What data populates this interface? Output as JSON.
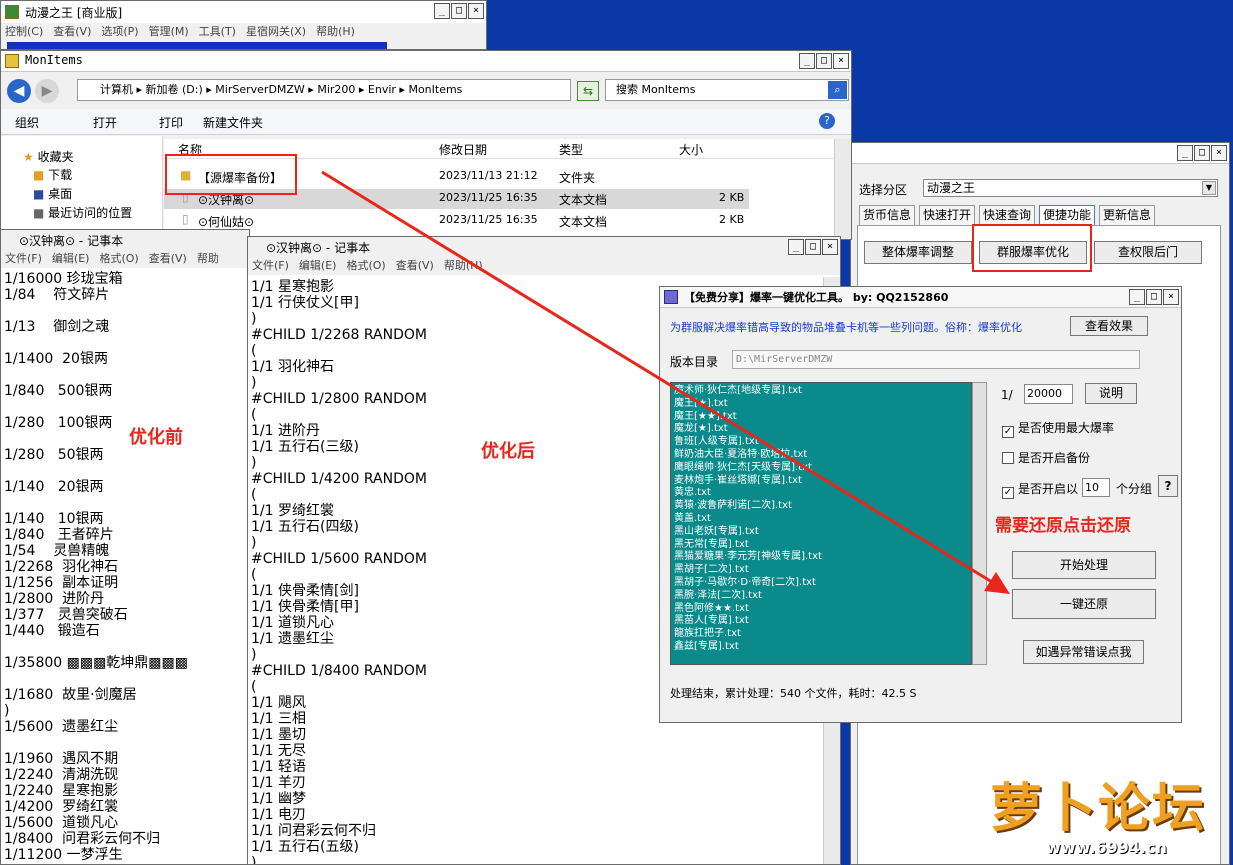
{
  "main_window": {
    "title": "动漫之王 [商业版]",
    "menu": [
      "控制(C)",
      "查看(V)",
      "选项(P)",
      "管理(M)",
      "工具(T)",
      "星宿网关(X)",
      "帮助(H)"
    ]
  },
  "explorer": {
    "title": "MonItems",
    "breadcrumb": [
      "计算机",
      "新加卷 (D:)",
      "MirServerDMZW",
      "Mir200",
      "Envir",
      "MonItems"
    ],
    "search_placeholder": "搜索 MonItems",
    "toolbar": {
      "organize": "组织",
      "open": "打开",
      "print": "打印",
      "new_folder": "新建文件夹"
    },
    "nav": [
      "收藏夹",
      "下载",
      "桌面",
      "最近访问的位置"
    ],
    "columns": [
      "名称",
      "修改日期",
      "类型",
      "大小"
    ],
    "files": [
      {
        "name": "【源爆率备份】",
        "date": "2023/11/13 21:12",
        "type": "文件夹",
        "size": ""
      },
      {
        "name": "⊙汉钟离⊙",
        "date": "2023/11/25 16:35",
        "type": "文本文档",
        "size": "2 KB"
      },
      {
        "name": "⊙何仙姑⊙",
        "date": "2023/11/25 16:35",
        "type": "文本文档",
        "size": "2 KB"
      }
    ]
  },
  "notepad1": {
    "title": "⊙汉钟离⊙ - 记事本",
    "menu": [
      "文件(F)",
      "编辑(E)",
      "格式(O)",
      "查看(V)",
      "帮助"
    ],
    "lines": [
      "1/16000 珍珑宝箱",
      "1/84    符文碎片",
      "",
      "1/13    御剑之魂",
      "",
      "1/1400  20银两",
      "",
      "1/840   500银两",
      "",
      "1/280   100银两",
      "",
      "1/280   50银两",
      "",
      "1/140   20银两",
      "",
      "1/140   10银两",
      "1/840   王者碎片",
      "1/54    灵兽精魄",
      "1/2268  羽化神石",
      "1/1256  副本证明",
      "1/2800  进阶丹",
      "1/377   灵兽突破石",
      "1/440   锻造石",
      "",
      "1/35800 ▩▩▩乾坤鼎▩▩▩",
      "",
      "1/1680  故里·剑魔居",
      ")",
      "1/5600  遗墨红尘",
      "",
      "1/1960  遇风不期",
      "1/2240  清湖洗砚",
      "1/2240  星寒抱影",
      "1/4200  罗绮红裳",
      "1/5600  道锁凡心",
      "1/8400  问君彩云何不归",
      "1/11200 一梦浮生"
    ]
  },
  "notepad2": {
    "title": "⊙汉钟离⊙ - 记事本",
    "menu": [
      "文件(F)",
      "编辑(E)",
      "格式(O)",
      "查看(V)",
      "帮助(H)"
    ],
    "lines": [
      "1/1 星寒抱影",
      "1/1 行侠仗义[甲]",
      ")",
      "#CHILD 1/2268 RANDOM",
      "(",
      "1/1 羽化神石",
      ")",
      "#CHILD 1/2800 RANDOM",
      "(",
      "1/1 进阶丹",
      "1/1 五行石(三级)",
      ")",
      "#CHILD 1/4200 RANDOM",
      "(",
      "1/1 罗绮红裳",
      "1/1 五行石(四级)",
      ")",
      "#CHILD 1/5600 RANDOM",
      "(",
      "1/1 侠骨柔情[剑]",
      "1/1 侠骨柔情[甲]",
      "1/1 道锁凡心",
      "1/1 遗墨红尘",
      ")",
      "#CHILD 1/8400 RANDOM",
      "(",
      "1/1 飓风",
      "1/1 三相",
      "1/1 墨切",
      "1/1 无尽",
      "1/1 轻语",
      "1/1 羊刃",
      "1/1 幽梦",
      "1/1 电刃",
      "1/1 问君彩云何不归",
      "1/1 五行石(五级)",
      ")"
    ]
  },
  "settings_window": {
    "label_partition": "选择分区",
    "partition_value": "动漫之王",
    "tabs": [
      "货币信息",
      "快速打开",
      "快速查询",
      "便捷功能",
      "更新信息"
    ],
    "buttons": [
      "整体爆率调整",
      "群服爆率优化",
      "查权限后门"
    ]
  },
  "tool": {
    "title": "【免费分享】爆率一键优化工具。   by: QQ2152860",
    "description": "为群服解决爆率错高导致的物品堆叠卡机等一些列问题。俗称：爆率优化",
    "view_effect": "查看效果",
    "version_dir_label": "版本目录",
    "version_dir_value": "D:\\MirServerDMZW",
    "ratio_prefix": "1/",
    "ratio_value": "20000",
    "explain": "说明",
    "opt_max": "是否使用最大爆率",
    "opt_backup": "是否开启备份",
    "opt_group_prefix": "是否开启以",
    "opt_group_value": "10",
    "opt_group_suffix": "个分组",
    "help": "?",
    "start": "开始处理",
    "restore": "一键还原",
    "error": "如遇异常错误点我",
    "status": "处理结束，累计处理：540 个文件，耗时：42.5 S",
    "files": [
      "魔术师·狄仁杰[地级专属].txt",
      "魔王[★].txt",
      "魔王[★★].txt",
      "魔龙[★].txt",
      "鲁班[人级专属].txt",
      "鲜奶油大臣·夏洛特·欧塔拉.txt",
      "鹰眼绳帅·狄仁杰[天级专属].txt",
      "麦林炮手·崔丝塔娜[专属].txt",
      "黄忠.txt",
      "黄猿·波鲁萨利诺[二次].txt",
      "黄盖.txt",
      "黑山老妖[专属].txt",
      "黑无常[专属].txt",
      "黑猫爱糖果·李元芳[神级专属].txt",
      "黑胡子[二次].txt",
      "黑胡子·马歇尔·D·帝奇[二次].txt",
      "黑腕·泽法[二次].txt",
      "黑色阿修★★.txt",
      "黑苗人[专属].txt",
      "龍族扛把子.txt",
      "鑫兹[专属].txt"
    ]
  },
  "annotations": {
    "before": "优化前",
    "after": "优化后",
    "restore_hint": "需要还原点击还原"
  },
  "watermark": {
    "text": "萝卜论坛",
    "url": "www.6994.cn"
  },
  "colors": {
    "desktop": "#0a38a6",
    "annotation_red": "#e8261c",
    "list_teal": "#0a8a8a",
    "watermark_orange": "#f0a020"
  }
}
